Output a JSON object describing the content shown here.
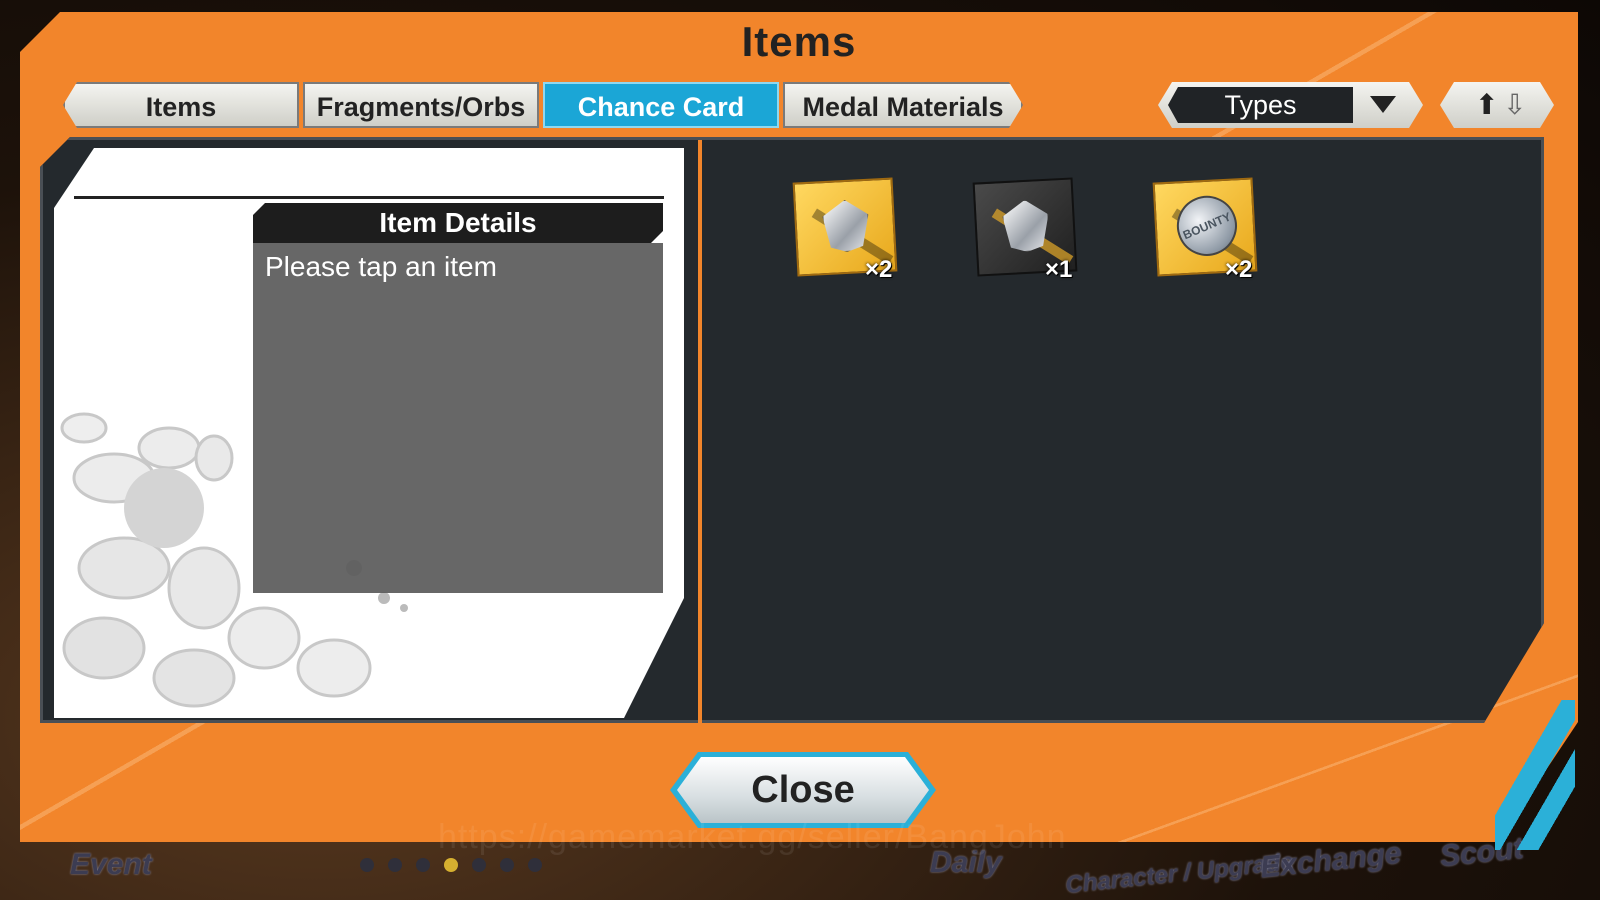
{
  "window": {
    "title": "Items"
  },
  "tabs": [
    {
      "label": "Items",
      "active": false
    },
    {
      "label": "Fragments/Orbs",
      "active": false
    },
    {
      "label": "Chance Card",
      "active": true
    },
    {
      "label": "Medal Materials",
      "active": false
    }
  ],
  "filter": {
    "label": "Types",
    "icon": "chevron-down-icon"
  },
  "sort": {
    "icons": [
      "arrow-up-icon",
      "arrow-down-icon"
    ]
  },
  "details": {
    "header": "Item Details",
    "message": "Please tap an item"
  },
  "inventory": [
    {
      "icon": "silver-gem-gold-card-icon",
      "quantity": "×2"
    },
    {
      "icon": "silver-gem-dark-card-icon",
      "quantity": "×1"
    },
    {
      "icon": "bounty-medal-card-icon",
      "quantity": "×2",
      "medal_text": "BOUNTY"
    }
  ],
  "footer": {
    "close_label": "Close"
  },
  "background_nav": [
    "Event",
    "Daily",
    "Character / Upgrade",
    "Exchange",
    "Scout"
  ],
  "watermark": "https://gamemarket.gg/seller/BangJohn",
  "colors": {
    "frame": "#f2852b",
    "active_tab": "#1ba6d6",
    "panel": "#24292d",
    "accent": "#2bb0d8"
  }
}
